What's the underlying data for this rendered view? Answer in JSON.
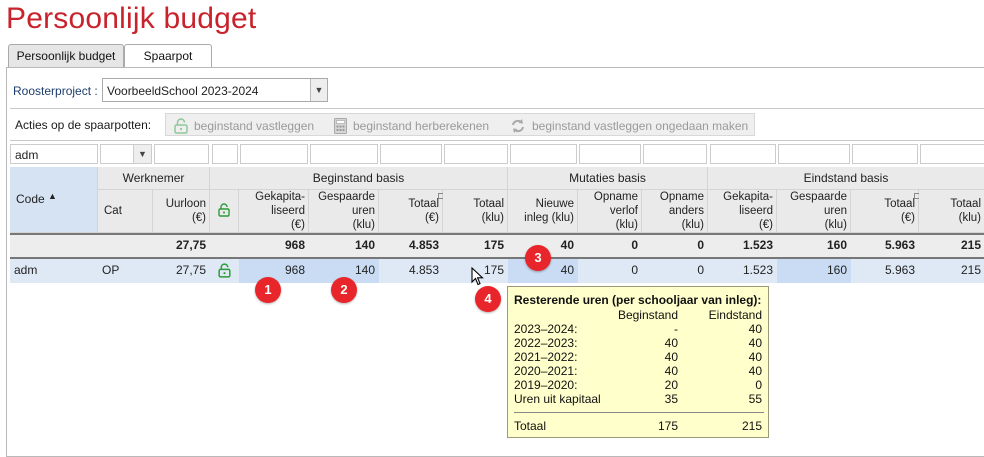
{
  "page": {
    "title": "Persoonlijk budget"
  },
  "tabs": [
    {
      "label": "Persoonlijk budget",
      "active": false
    },
    {
      "label": "Spaarpot",
      "active": true
    }
  ],
  "project": {
    "label": "Roosterproject :",
    "value": "VoorbeeldSchool 2023-2024"
  },
  "actions": {
    "label": "Acties op de spaarpotten:",
    "items": [
      {
        "label": "beginstand vastleggen",
        "icon": "lock-open-icon",
        "enabled": false
      },
      {
        "label": "beginstand herberekenen",
        "icon": "calculator-icon",
        "enabled": false
      },
      {
        "label": "beginstand vastleggen ongedaan maken",
        "icon": "undo-refresh-icon",
        "enabled": false
      }
    ]
  },
  "filter": {
    "code": "adm"
  },
  "columns": {
    "code": "Code",
    "groups": {
      "werknemer": "Werknemer",
      "beginstand": "Beginstand basis",
      "mutaties": "Mutaties basis",
      "eindstand": "Eindstand basis"
    },
    "cat": "Cat",
    "uurloon": [
      "Uurloon",
      "(€)"
    ],
    "gekap": [
      "Gekapita-",
      "liseerd",
      "(€)"
    ],
    "gesp": [
      "Gespaarde",
      "uren",
      "(klu)"
    ],
    "totaal_eur": [
      "Totaal",
      "(€)"
    ],
    "totaal_klu": [
      "Totaal",
      "(klu)"
    ],
    "nieuwe": [
      "Nieuwe",
      "inleg (klu)"
    ],
    "opname_verlof": [
      "Opname",
      "verlof",
      "(klu)"
    ],
    "opname_anders": [
      "Opname",
      "anders",
      "(klu)"
    ],
    "eind_gekap": [
      "Gekapita-",
      "liseerd",
      "(€)"
    ],
    "eind_gesp": [
      "Gespaarde",
      "uren",
      "(klu)"
    ],
    "eind_tot_eur": [
      "Totaal",
      "(€)"
    ],
    "eind_tot_klu": [
      "Totaal",
      "(klu)"
    ]
  },
  "totals": {
    "uurloon": "27,75",
    "gekap": "968",
    "gesp": "140",
    "tot_eur": "4.853",
    "tot_klu": "175",
    "nieuwe": "40",
    "verlof": "0",
    "anders": "0",
    "e_gekap": "1.523",
    "e_gesp": "160",
    "e_tot_eur": "5.963",
    "e_tot_klu": "215"
  },
  "row": {
    "code": "adm",
    "cat": "OP",
    "uurloon": "27,75",
    "gekap": "968",
    "gesp": "140",
    "tot_eur": "4.853",
    "tot_klu": "175",
    "nieuwe": "40",
    "verlof": "0",
    "anders": "0",
    "e_gekap": "1.523",
    "e_gesp": "160",
    "e_tot_eur": "5.963",
    "e_tot_klu": "215"
  },
  "badges": [
    "1",
    "2",
    "3",
    "4"
  ],
  "tooltip": {
    "title": "Resterende uren (per schooljaar van inleg):",
    "col_begin": "Beginstand",
    "col_eind": "Eindstand",
    "rows": [
      {
        "label": "2023–2024:",
        "begin": "-",
        "eind": "40"
      },
      {
        "label": "2022–2023:",
        "begin": "40",
        "eind": "40"
      },
      {
        "label": "2021–2022:",
        "begin": "40",
        "eind": "40"
      },
      {
        "label": "2020–2021:",
        "begin": "40",
        "eind": "40"
      },
      {
        "label": "2019–2020:",
        "begin": "20",
        "eind": "0"
      },
      {
        "label": "Uren uit kapitaal",
        "begin": "35",
        "eind": "55"
      }
    ],
    "total": {
      "label": "Totaal",
      "begin": "175",
      "eind": "215"
    }
  },
  "colors": {
    "title_red": "#c8232c",
    "badge_red": "#e8252a",
    "lock_green": "#2e9b3a",
    "row_highlight": "#dfe9f6",
    "tooltip_bg": "#ffffcc"
  }
}
